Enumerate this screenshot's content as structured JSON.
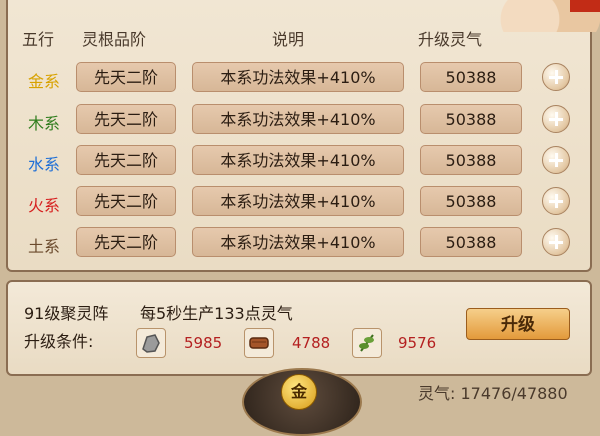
{
  "headers": [
    "五行",
    "灵根品阶",
    "说明",
    "升级灵气"
  ],
  "rows": [
    {
      "element": "金系",
      "color": "#d8a200",
      "grade": "先天二阶",
      "desc": "本系功法效果+410%",
      "cost": "50388"
    },
    {
      "element": "木系",
      "color": "#2f7d1d",
      "grade": "先天二阶",
      "desc": "本系功法效果+410%",
      "cost": "50388"
    },
    {
      "element": "水系",
      "color": "#1f6fd6",
      "grade": "先天二阶",
      "desc": "本系功法效果+410%",
      "cost": "50388"
    },
    {
      "element": "火系",
      "color": "#d61f1f",
      "grade": "先天二阶",
      "desc": "本系功法效果+410%",
      "cost": "50388"
    },
    {
      "element": "土系",
      "color": "#6b4a2d",
      "grade": "先天二阶",
      "desc": "本系功法效果+410%",
      "cost": "50388"
    }
  ],
  "array_title": "91级聚灵阵",
  "production": "每5秒生产133点灵气",
  "upgrade_cond": "升级条件:",
  "resources": [
    {
      "icon": "ore-icon",
      "value": "5985"
    },
    {
      "icon": "wood-icon",
      "value": "4788"
    },
    {
      "icon": "herb-icon",
      "value": "9576"
    }
  ],
  "upgrade_label": "升级",
  "gold_label": "金",
  "qi_text": "灵气: 17476/47880"
}
